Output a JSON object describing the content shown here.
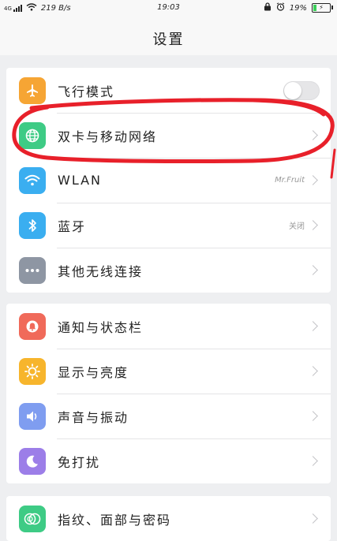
{
  "status_bar": {
    "signal": "4G",
    "speed": "219 B/s",
    "time": "19:03",
    "battery": "19"
  },
  "header": {
    "title": "设置"
  },
  "groups": [
    {
      "items": [
        {
          "label": "飞行模式",
          "icon": "airplane-icon",
          "color": "#f6a534",
          "control": "toggle",
          "toggle_on": false
        },
        {
          "label": "双卡与移动网络",
          "icon": "globe-icon",
          "color": "#3ecb85",
          "control": "chevron"
        },
        {
          "label": "WLAN",
          "icon": "wifi-icon",
          "color": "#3aaef0",
          "value": "Mr.Fruit",
          "control": "chevron"
        },
        {
          "label": "蓝牙",
          "icon": "bluetooth-icon",
          "color": "#3aaef0",
          "value": "关闭",
          "control": "chevron"
        },
        {
          "label": "其他无线连接",
          "icon": "more-icon",
          "color": "#8e96a3",
          "control": "chevron"
        }
      ]
    },
    {
      "items": [
        {
          "label": "通知与状态栏",
          "icon": "bell-icon",
          "color": "#f06a5a",
          "control": "chevron"
        },
        {
          "label": "显示与亮度",
          "icon": "sun-icon",
          "color": "#f7b52c",
          "control": "chevron"
        },
        {
          "label": "声音与振动",
          "icon": "speaker-icon",
          "color": "#7f9df0",
          "control": "chevron"
        },
        {
          "label": "免打扰",
          "icon": "moon-icon",
          "color": "#9c7ee8",
          "control": "chevron"
        }
      ]
    },
    {
      "items": [
        {
          "label": "指纹、面部与密码",
          "icon": "fingerprint-icon",
          "color": "#3ecb85",
          "control": "chevron"
        }
      ]
    }
  ],
  "annotation_color": "#e8202a"
}
